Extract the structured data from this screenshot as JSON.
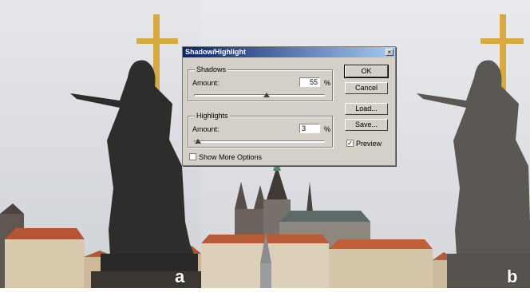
{
  "dialog": {
    "title": "Shadow/Highlight",
    "close_glyph": "×",
    "shadows": {
      "legend": "Shadows",
      "amount_label": "Amount:",
      "amount_value": "55",
      "unit": "%",
      "slider_level_percent": 55
    },
    "highlights": {
      "legend": "Highlights",
      "amount_label": "Amount:",
      "amount_value": "3",
      "unit": "%",
      "slider_level_percent": 3
    },
    "show_more_options_label": "Show More Options",
    "show_more_options_checked": false,
    "buttons": {
      "ok": "OK",
      "cancel": "Cancel",
      "load": "Load...",
      "save": "Save..."
    },
    "preview_label": "Preview",
    "preview_checked": true,
    "check_glyph": "✓"
  },
  "panel_labels": {
    "a": "a",
    "b": "b"
  },
  "colors": {
    "title_start": "#0a246a",
    "title_end": "#a6caf0",
    "dialog_bg": "#d4d0c8",
    "sky": "#d9dbe0",
    "statue_dark": "#2b2a29",
    "statue_light": "#5a5754",
    "roof": "#c15a35",
    "cross": "#d5a847"
  }
}
